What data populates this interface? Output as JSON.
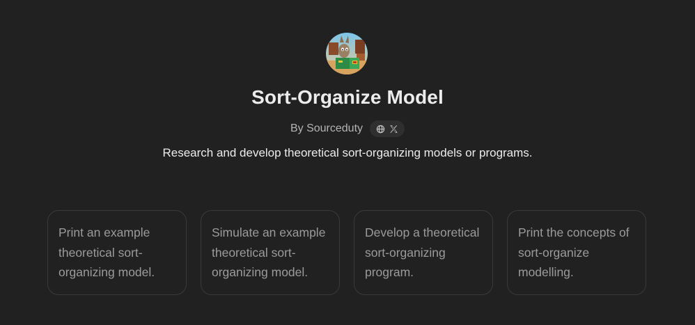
{
  "gpt": {
    "title": "Sort-Organize Model",
    "byline": "By Sourceduty",
    "description": "Research and develop theoretical sort-organizing models or programs.",
    "avatar_icon": "cartoon-coyote-with-crates-icon",
    "social_icons": [
      "globe-icon",
      "x-logo-icon"
    ]
  },
  "starters": [
    {
      "label": "Print an example theoretical sort-organizing model."
    },
    {
      "label": "Simulate an example theoretical sort-organizing model."
    },
    {
      "label": "Develop a theoretical sort-organizing program."
    },
    {
      "label": "Print the concepts of sort-organize modelling."
    }
  ],
  "colors": {
    "background": "#212121",
    "title": "#ececec",
    "muted": "#b4b4b4",
    "card_text": "#9b9b9b",
    "card_border": "#3a3a3a"
  }
}
